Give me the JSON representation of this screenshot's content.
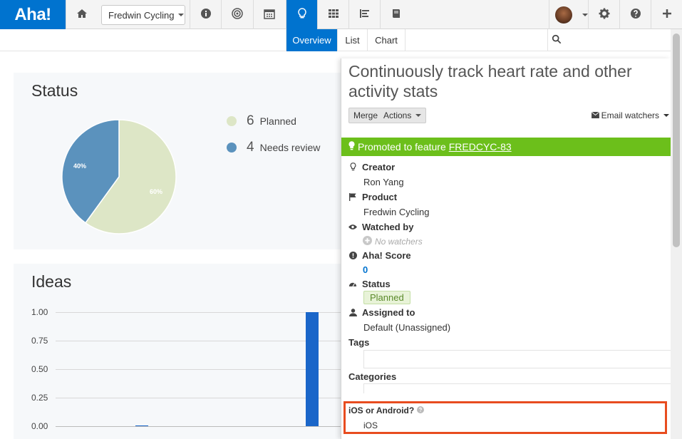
{
  "app": {
    "logo": "Aha!"
  },
  "nav": {
    "product_selector": "Fredwin Cycling",
    "icons": [
      "home-icon",
      "info-icon",
      "target-icon",
      "calendar-icon",
      "lightbulb-icon",
      "grid-icon",
      "align-left-icon",
      "book-icon",
      "gear-icon",
      "help-icon",
      "plus-icon"
    ],
    "active": "lightbulb-icon"
  },
  "subnav": {
    "tabs": [
      "Overview",
      "List",
      "Chart"
    ],
    "active": "Overview"
  },
  "status_panel": {
    "title": "Status",
    "legend": [
      {
        "count": "6",
        "label": "Planned",
        "color": "#dde6c6"
      },
      {
        "count": "4",
        "label": "Needs review",
        "color": "#5b92bd"
      }
    ],
    "chart_data": {
      "type": "pie",
      "slices": [
        {
          "label": "Planned",
          "value": 60,
          "text": "60%",
          "color": "#dde6c6"
        },
        {
          "label": "Needs review",
          "value": 40,
          "text": "40%",
          "color": "#5b92bd"
        }
      ]
    }
  },
  "ideas_panel": {
    "title": "Ideas",
    "chart_data": {
      "type": "bar",
      "ytick_labels": [
        "1.00",
        "0.75",
        "0.50",
        "0.25",
        "0.00"
      ],
      "ylim": [
        0,
        1
      ],
      "bars": [
        {
          "value": 0.005,
          "color": "#1a66c9"
        },
        {
          "value": 1.0,
          "color": "#1a66c9"
        }
      ]
    }
  },
  "detail": {
    "title": "Continuously track heart rate and other activity stats",
    "merge_label": "Merge",
    "actions_label": "Actions",
    "email_watchers": "Email watchers",
    "promoted_prefix": "Promoted to feature",
    "promoted_link": "FREDCYC-83",
    "fields": {
      "creator_label": "Creator",
      "creator_value": "Ron Yang",
      "product_label": "Product",
      "product_value": "Fredwin Cycling",
      "watched_label": "Watched by",
      "watched_value": "No watchers",
      "score_label": "Aha! Score",
      "score_value": "0",
      "status_label": "Status",
      "status_value": "Planned",
      "assigned_label": "Assigned to",
      "assigned_value": "Default (Unassigned)",
      "tags_label": "Tags",
      "categories_label": "Categories",
      "custom_label": "iOS or Android?",
      "custom_value": "iOS"
    },
    "colors": {
      "promoted_bg": "#6cbf1b",
      "highlight": "#e84c1f",
      "link": "#0073cf"
    }
  }
}
